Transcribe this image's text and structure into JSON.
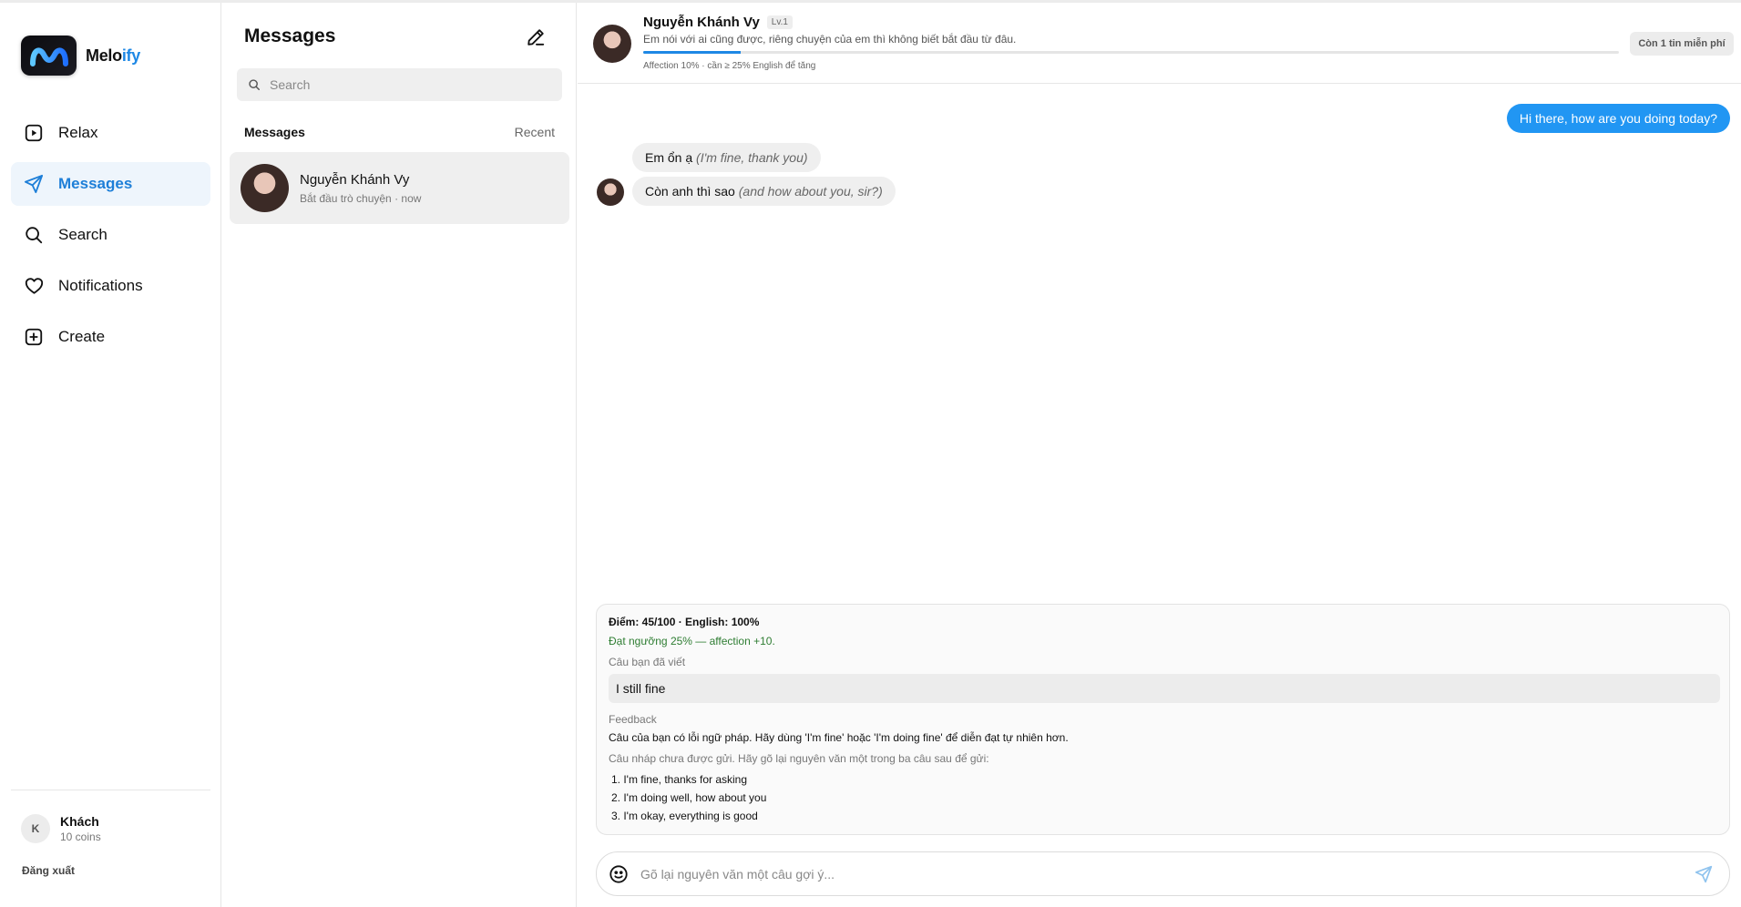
{
  "app": {
    "brand_part1": "Melo",
    "brand_part2": "ify",
    "accent_color": "#1e88e5"
  },
  "sidebar": {
    "items": [
      {
        "label": "Relax",
        "icon": "play-square-icon"
      },
      {
        "label": "Messages",
        "icon": "send-icon",
        "active": true
      },
      {
        "label": "Search",
        "icon": "search-icon"
      },
      {
        "label": "Notifications",
        "icon": "heart-icon"
      },
      {
        "label": "Create",
        "icon": "plus-square-icon"
      }
    ],
    "user": {
      "initial": "K",
      "name": "Khách",
      "coins": "10 coins"
    },
    "logout_label": "Đăng xuất"
  },
  "conversations": {
    "title": "Messages",
    "search_placeholder": "Search",
    "section_title": "Messages",
    "sort_label": "Recent",
    "items": [
      {
        "name": "Nguyễn Khánh Vy",
        "subtitle": "Bắt đầu trò chuyện · now"
      }
    ]
  },
  "chat": {
    "contact_name": "Nguyễn Khánh Vy",
    "level_badge": "Lv.1",
    "status_text": "Em nói với ai cũng được, riêng chuyện của em thì không biết bắt đầu từ đâu.",
    "affection_progress": 0.1,
    "affection_text": "Affection 10% · cần ≥ 25% English để tăng",
    "free_messages": "Còn 1 tin miễn phí",
    "messages": [
      {
        "from": "me",
        "text": "Hi there, how are you doing today?"
      },
      {
        "from": "them",
        "text": "Em ổn ạ",
        "translation": "(I'm fine, thank you)"
      },
      {
        "from": "them",
        "text": "Còn anh thì sao",
        "translation": "(and how about you, sir?)"
      }
    ],
    "feedback": {
      "score": "Điểm: 45/100 · English: 100%",
      "threshold": "Đạt ngưỡng 25% — affection +10.",
      "written_label": "Câu bạn đã viết",
      "written_text": "I still fine",
      "feedback_label": "Feedback",
      "feedback_text": "Câu của bạn có lỗi ngữ pháp. Hãy dùng 'I'm fine' hoặc 'I'm doing fine' để diễn đạt tự nhiên hơn.",
      "draft_note": "Câu nháp chưa được gửi. Hãy gõ lại nguyên văn một trong ba câu sau để gửi:",
      "suggestions": [
        "1. I'm fine, thanks for asking",
        "2. I'm doing well, how about you",
        "3. I'm okay, everything is good"
      ]
    },
    "input_placeholder": "Gõ lại nguyên văn một câu gợi ý..."
  }
}
